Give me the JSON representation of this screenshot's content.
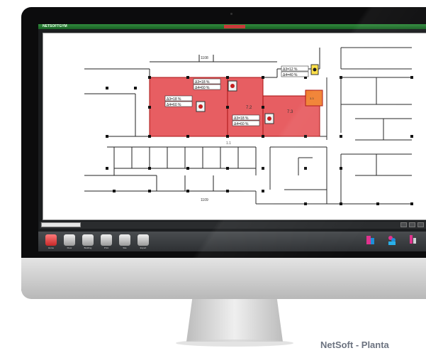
{
  "app": {
    "title": "NETSOFTGYM"
  },
  "floorplan": {
    "top_label": "1108",
    "bottom_label": "1109",
    "corridor_label": "1.1",
    "zone_labels": [
      "7.2",
      "7.3",
      "3.3"
    ],
    "sensors": [
      {
        "temp": "Δ3=18 %",
        "hum": "Δ4=60 %"
      },
      {
        "temp": "Δ3=18 %",
        "hum": "Δ4=60 %"
      },
      {
        "temp": "Δ3=18 %",
        "hum": "Δ4=60 %"
      },
      {
        "temp": "Δ3=12 %",
        "hum": "Δ4=40 %"
      }
    ]
  },
  "toolbar": {
    "buttons": [
      "Home",
      "Floor",
      "Building",
      "Print",
      "Site",
      "Export"
    ]
  },
  "caption": "NetSoft - Planta"
}
